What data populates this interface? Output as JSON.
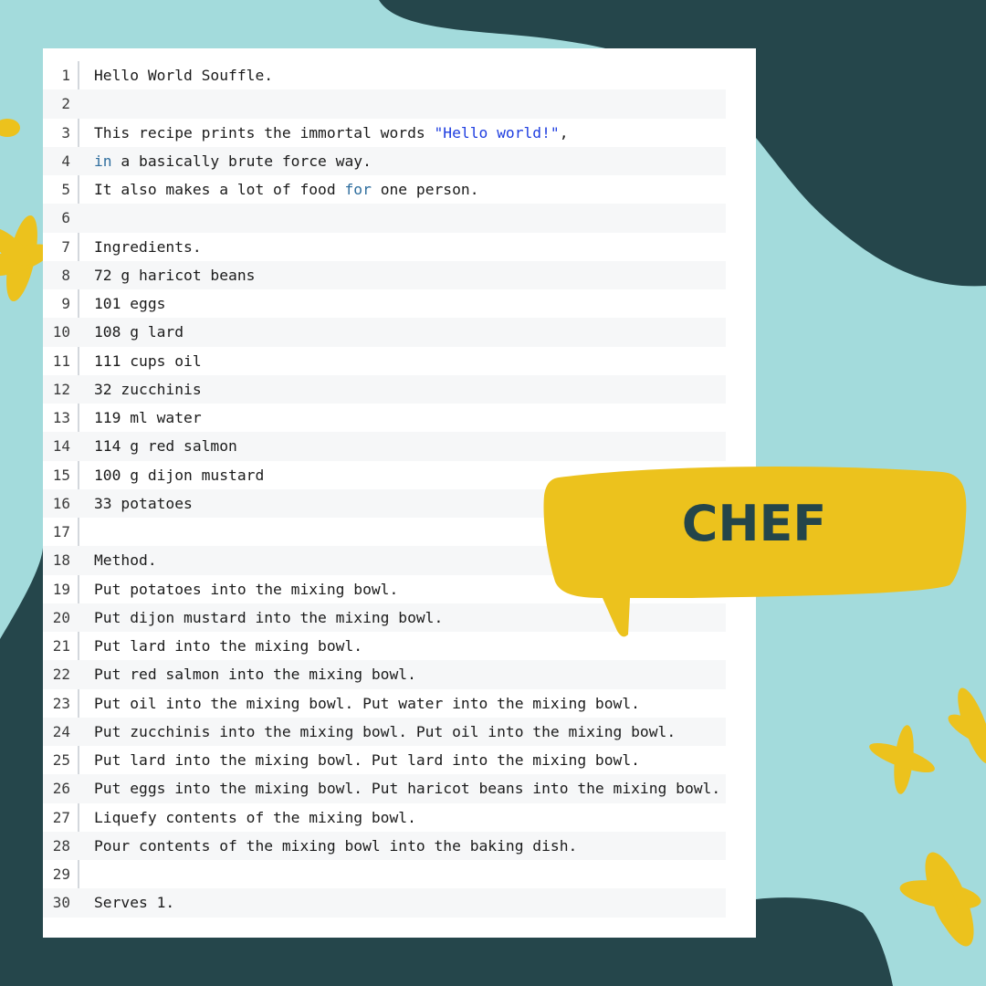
{
  "colors": {
    "background": "#a3dbdc",
    "dark_blob": "#25464b",
    "accent_yellow": "#ecc21d",
    "string": "#1f3ee0",
    "keyword": "#2f6e9e"
  },
  "badge": {
    "label": "CHEF"
  },
  "code": {
    "lines": [
      {
        "num": "1",
        "segments": [
          {
            "text": "Hello World Souffle."
          }
        ]
      },
      {
        "num": "2",
        "segments": [
          {
            "text": ""
          }
        ]
      },
      {
        "num": "3",
        "segments": [
          {
            "text": "This recipe prints the immortal words "
          },
          {
            "text": "\"Hello world!\"",
            "style": "str"
          },
          {
            "text": ","
          }
        ]
      },
      {
        "num": "4",
        "segments": [
          {
            "text": "in",
            "style": "kw"
          },
          {
            "text": " a basically brute force way."
          }
        ]
      },
      {
        "num": "5",
        "segments": [
          {
            "text": "It also makes a lot of food "
          },
          {
            "text": "for",
            "style": "kw"
          },
          {
            "text": " one person."
          }
        ]
      },
      {
        "num": "6",
        "segments": [
          {
            "text": ""
          }
        ]
      },
      {
        "num": "7",
        "segments": [
          {
            "text": "Ingredients."
          }
        ]
      },
      {
        "num": "8",
        "segments": [
          {
            "text": "72 g haricot beans"
          }
        ]
      },
      {
        "num": "9",
        "segments": [
          {
            "text": "101 eggs"
          }
        ]
      },
      {
        "num": "10",
        "segments": [
          {
            "text": "108 g lard"
          }
        ]
      },
      {
        "num": "11",
        "segments": [
          {
            "text": "111 cups oil"
          }
        ]
      },
      {
        "num": "12",
        "segments": [
          {
            "text": "32 zucchinis"
          }
        ]
      },
      {
        "num": "13",
        "segments": [
          {
            "text": "119 ml water"
          }
        ]
      },
      {
        "num": "14",
        "segments": [
          {
            "text": "114 g red salmon"
          }
        ]
      },
      {
        "num": "15",
        "segments": [
          {
            "text": "100 g dijon mustard"
          }
        ]
      },
      {
        "num": "16",
        "segments": [
          {
            "text": "33 potatoes"
          }
        ]
      },
      {
        "num": "17",
        "segments": [
          {
            "text": ""
          }
        ]
      },
      {
        "num": "18",
        "segments": [
          {
            "text": "Method."
          }
        ]
      },
      {
        "num": "19",
        "segments": [
          {
            "text": "Put potatoes into the mixing bowl."
          }
        ]
      },
      {
        "num": "20",
        "segments": [
          {
            "text": "Put dijon mustard into the mixing bowl."
          }
        ]
      },
      {
        "num": "21",
        "segments": [
          {
            "text": "Put lard into the mixing bowl."
          }
        ]
      },
      {
        "num": "22",
        "segments": [
          {
            "text": "Put red salmon into the mixing bowl."
          }
        ]
      },
      {
        "num": "23",
        "segments": [
          {
            "text": "Put oil into the mixing bowl. Put water into the mixing bowl."
          }
        ]
      },
      {
        "num": "24",
        "segments": [
          {
            "text": "Put zucchinis into the mixing bowl. Put oil into the mixing bowl."
          }
        ]
      },
      {
        "num": "25",
        "segments": [
          {
            "text": "Put lard into the mixing bowl. Put lard into the mixing bowl."
          }
        ]
      },
      {
        "num": "26",
        "segments": [
          {
            "text": "Put eggs into the mixing bowl. Put haricot beans into the mixing bowl."
          }
        ]
      },
      {
        "num": "27",
        "segments": [
          {
            "text": "Liquefy contents of the mixing bowl."
          }
        ]
      },
      {
        "num": "28",
        "segments": [
          {
            "text": "Pour contents of the mixing bowl into the baking dish."
          }
        ]
      },
      {
        "num": "29",
        "segments": [
          {
            "text": ""
          }
        ]
      },
      {
        "num": "30",
        "segments": [
          {
            "text": "Serves 1."
          }
        ]
      }
    ]
  }
}
